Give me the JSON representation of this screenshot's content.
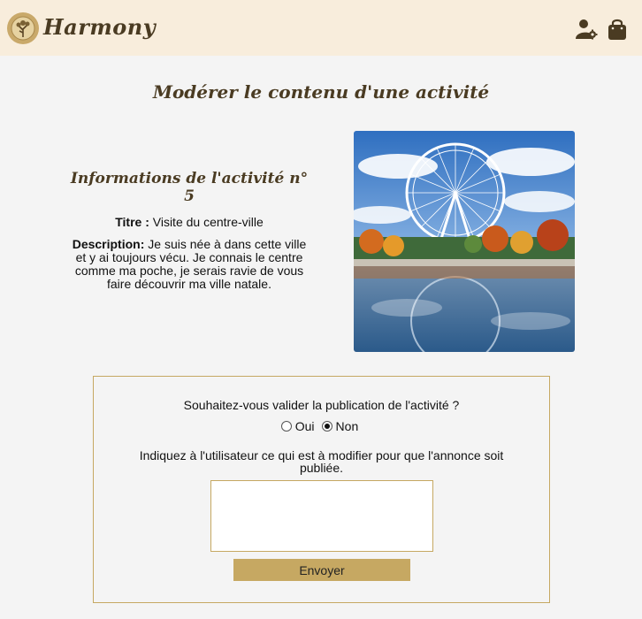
{
  "nav": {
    "brand": "Harmony",
    "user_settings_icon": "user-gear-icon",
    "cart_icon": "shopping-bag-icon"
  },
  "page": {
    "title": "Modérer le contenu d'une activité"
  },
  "activity": {
    "heading": "Informations de l'activité n° 5",
    "title_label": "Titre :",
    "title_value": "Visite du centre-ville",
    "description_label": "Description:",
    "description_value": "Je suis née à dans cette ville et y ai toujours vécu. Je connais le centre comme ma poche, je serais ravie de vous faire découvrir ma ville natale."
  },
  "moderation": {
    "question": "Souhaitez-vous valider la publication de l'activité ?",
    "options": [
      "Oui",
      "Non"
    ],
    "selected": "Non",
    "instruction": "Indiquez à l'utilisateur ce qui est à modifier pour que l'annonce soit publiée.",
    "message_value": "",
    "submit_label": "Envoyer"
  },
  "colors": {
    "navbar_bg": "#f8eddc",
    "accent": "#c6a862",
    "title": "#4a3b22",
    "page_bg": "#f4f4f4"
  }
}
